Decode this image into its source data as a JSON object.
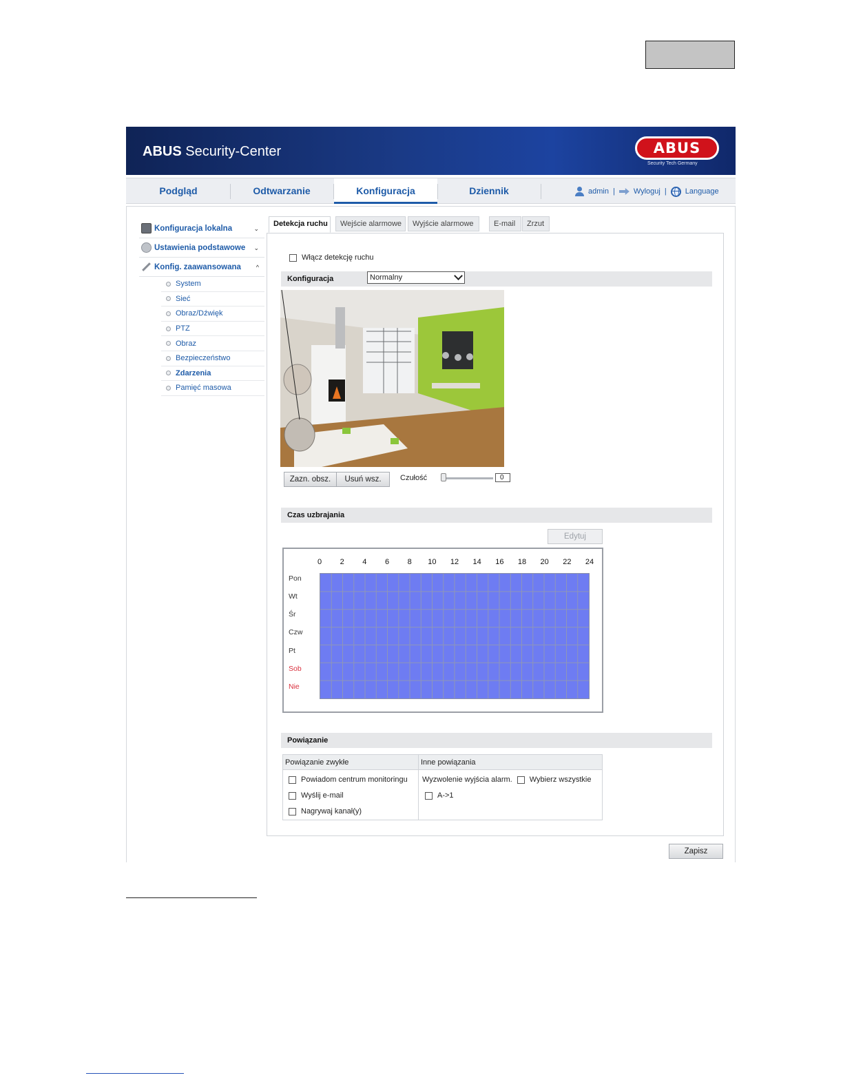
{
  "header": {
    "brand_bold": "ABUS",
    "brand_rest": " Security-Center",
    "logo_text": "ABUS",
    "logo_tagline": "Security Tech Germany"
  },
  "main_tabs": [
    {
      "label": "Podgląd",
      "active": false
    },
    {
      "label": "Odtwarzanie",
      "active": false
    },
    {
      "label": "Konfiguracja",
      "active": true
    },
    {
      "label": "Dziennik",
      "active": false
    }
  ],
  "user_bar": {
    "user": "admin",
    "logout": "Wyloguj",
    "language": "Language",
    "separator": "|"
  },
  "sidebar": {
    "groups": [
      {
        "label": "Konfiguracja lokalna",
        "icon": "monitor-icon",
        "chevron": "⌄"
      },
      {
        "label": "Ustawienia podstawowe",
        "icon": "settings-icon",
        "chevron": "⌄"
      },
      {
        "label": "Konfig. zaawansowana",
        "icon": "wrench-icon",
        "chevron": "^"
      }
    ],
    "items": [
      {
        "label": "System",
        "active": false
      },
      {
        "label": "Sieć",
        "active": false
      },
      {
        "label": "Obraz/Dźwięk",
        "active": false
      },
      {
        "label": "PTZ",
        "active": false
      },
      {
        "label": "Obraz",
        "active": false
      },
      {
        "label": "Bezpieczeństwo",
        "active": false
      },
      {
        "label": "Zdarzenia",
        "active": true
      },
      {
        "label": "Pamięć masowa",
        "active": false
      }
    ]
  },
  "sub_tabs": [
    {
      "label": "Detekcja ruchu",
      "active": true
    },
    {
      "label": "Wejście alarmowe",
      "active": false
    },
    {
      "label": "Wyjście alarmowe",
      "active": false
    },
    {
      "label": "E-mail",
      "active": false
    },
    {
      "label": "Zrzut",
      "active": false
    }
  ],
  "motion": {
    "enable_label": "Włącz detekcję ruchu",
    "enable_checked": false,
    "config_label": "Konfiguracja",
    "config_value": "Normalny",
    "draw_area_button": "Zazn. obsz.",
    "clear_all_button": "Usuń wsz.",
    "sensitivity_label": "Czułość",
    "sensitivity_value": "0"
  },
  "schedule": {
    "section_title": "Czas uzbrajania",
    "edit_button": "Edytuj",
    "hours": [
      "0",
      "2",
      "4",
      "6",
      "8",
      "10",
      "12",
      "14",
      "16",
      "18",
      "20",
      "22",
      "24"
    ],
    "days": [
      {
        "label": "Pon",
        "weekend": false
      },
      {
        "label": "Wt",
        "weekend": false
      },
      {
        "label": "Śr",
        "weekend": false
      },
      {
        "label": "Czw",
        "weekend": false
      },
      {
        "label": "Pt",
        "weekend": false
      },
      {
        "label": "Sob",
        "weekend": true
      },
      {
        "label": "Nie",
        "weekend": true
      }
    ],
    "grid_color": "#6e7cf2"
  },
  "linkage": {
    "section_title": "Powiązanie",
    "normal_header": "Powiązanie zwykłe",
    "other_header": "Inne powiązania",
    "normal_items": [
      {
        "label": "Powiadom centrum monitoringu",
        "checked": false
      },
      {
        "label": "Wyślij e-mail",
        "checked": false
      },
      {
        "label": "Nagrywaj kanał(y)",
        "checked": false
      }
    ],
    "trigger_label": "Wyzwolenie wyjścia alarm.",
    "select_all_label": "Wybierz wszystkie",
    "outputs": [
      {
        "label": "A->1",
        "checked": false
      }
    ]
  },
  "save_button": "Zapisz",
  "colors": {
    "accent": "#1e5ba8",
    "banner": "#1a3a86",
    "logo_red": "#d0121b",
    "weekend": "#d9303d"
  }
}
